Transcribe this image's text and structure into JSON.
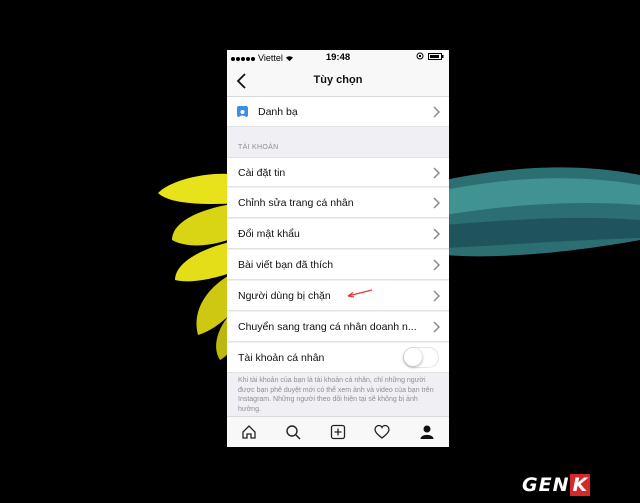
{
  "status_bar": {
    "carrier": "Viettel",
    "time": "19:48"
  },
  "navbar": {
    "title": "Tùy chọn"
  },
  "contacts_row": {
    "label": "Danh bạ"
  },
  "account_section": {
    "header": "TÀI KHOẢN",
    "items": [
      {
        "label": "Cài đặt tin"
      },
      {
        "label": "Chỉnh sửa trang cá nhân"
      },
      {
        "label": "Đổi mật khẩu"
      },
      {
        "label": "Bài viết bạn đã thích"
      },
      {
        "label": "Người dùng bị chặn"
      },
      {
        "label": "Chuyển sang trang cá nhân doanh n..."
      }
    ],
    "private_toggle": {
      "label": "Tài khoản cá nhân",
      "on": false
    },
    "footer_note": "Khi tài khoản của bạn là tài khoản cá nhân, chỉ những người được bạn phê duyệt mới có thể xem ảnh và video của bạn trên Instagram. Những người theo dõi hiện tại sẽ không bị ảnh hưởng."
  },
  "tab_bar": [
    "home-icon",
    "search-icon",
    "add-icon",
    "heart-icon",
    "profile-icon"
  ],
  "watermark": {
    "text": "GEN",
    "accent": "K"
  },
  "colors": {
    "accent_blue": "#3e8ee6",
    "arrow_red": "#e53935",
    "logo_red": "#d62828"
  }
}
